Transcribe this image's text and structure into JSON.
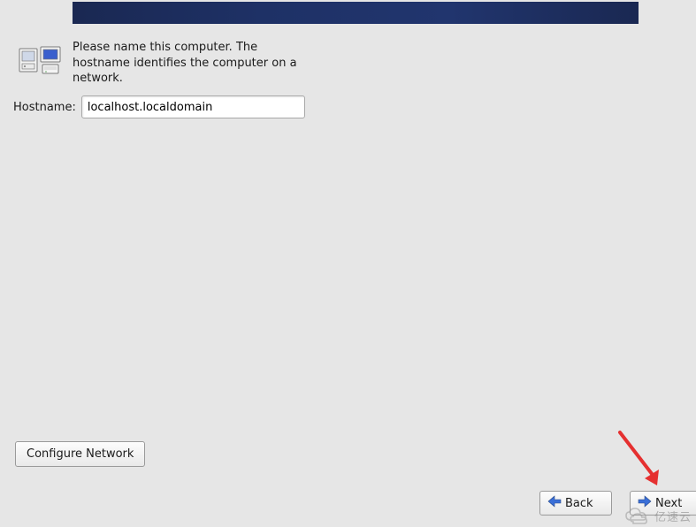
{
  "intro": {
    "text": "Please name this computer.  The hostname identifies the computer on a network."
  },
  "hostname": {
    "label": "Hostname:",
    "value": "localhost.localdomain"
  },
  "buttons": {
    "configure_network": "Configure Network",
    "back": "Back",
    "next": "Next"
  },
  "watermark": {
    "text": "亿速云"
  }
}
